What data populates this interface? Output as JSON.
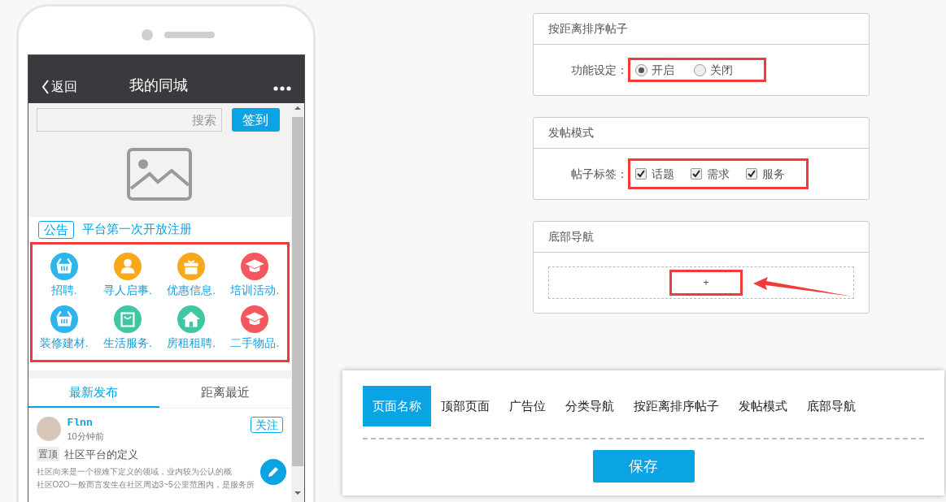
{
  "phone": {
    "nav": {
      "back": "返回",
      "title": "我的同城"
    },
    "search": {
      "placeholder": "搜索",
      "button": "签到"
    },
    "notice": {
      "tag": "公告",
      "text": "平台第一次开放注册"
    },
    "categories": [
      {
        "label": "招聘.",
        "kind": "basket",
        "color": "#2eb5ec"
      },
      {
        "label": "寻人启事.",
        "kind": "person",
        "color": "#f8a91b"
      },
      {
        "label": "优惠信息.",
        "kind": "gift",
        "color": "#f8a91b"
      },
      {
        "label": "培训活动.",
        "kind": "cap",
        "color": "#f5575c"
      },
      {
        "label": "装修建材.",
        "kind": "basket",
        "color": "#2eb5ec"
      },
      {
        "label": "生活服务.",
        "kind": "bag",
        "color": "#3ec7a2"
      },
      {
        "label": "房租租聘.",
        "kind": "house",
        "color": "#3ec7a2"
      },
      {
        "label": "二手物品.",
        "kind": "cap",
        "color": "#f5575c"
      }
    ],
    "feed_tabs": [
      {
        "label": "最新发布",
        "selected": true
      },
      {
        "label": "距离最近",
        "selected": false
      }
    ],
    "post": {
      "author": "Flnn",
      "time": "10分钟前",
      "follow": "关注",
      "pin": "置顶",
      "title": "社区平台的定义",
      "lines": [
        "社区向来是一个很难下定义的领域，业内较为公认的概",
        "社区O2O一般而言发生在社区周边3~5公里范围内，是服务所"
      ]
    }
  },
  "panels": [
    {
      "title": "按距离排序帖子",
      "kind": "radio",
      "label": "功能设定：",
      "options": [
        {
          "label": "开启",
          "selected": true
        },
        {
          "label": "关闭",
          "selected": false
        }
      ]
    },
    {
      "title": "发帖模式",
      "kind": "checkbox",
      "label": "帖子标签：",
      "options": [
        {
          "label": "话题",
          "checked": true
        },
        {
          "label": "需求",
          "checked": true
        },
        {
          "label": "服务",
          "checked": true
        }
      ]
    },
    {
      "title": "底部导航",
      "kind": "add",
      "button": "+"
    }
  ],
  "editor": {
    "tabs": [
      {
        "label": "页面名称",
        "selected": true
      },
      {
        "label": "顶部页面",
        "selected": false
      },
      {
        "label": "广告位",
        "selected": false
      },
      {
        "label": "分类导航",
        "selected": false
      },
      {
        "label": "按距离排序帖子",
        "selected": false
      },
      {
        "label": "发帖模式",
        "selected": false
      },
      {
        "label": "底部导航",
        "selected": false
      }
    ],
    "save": "保存"
  }
}
